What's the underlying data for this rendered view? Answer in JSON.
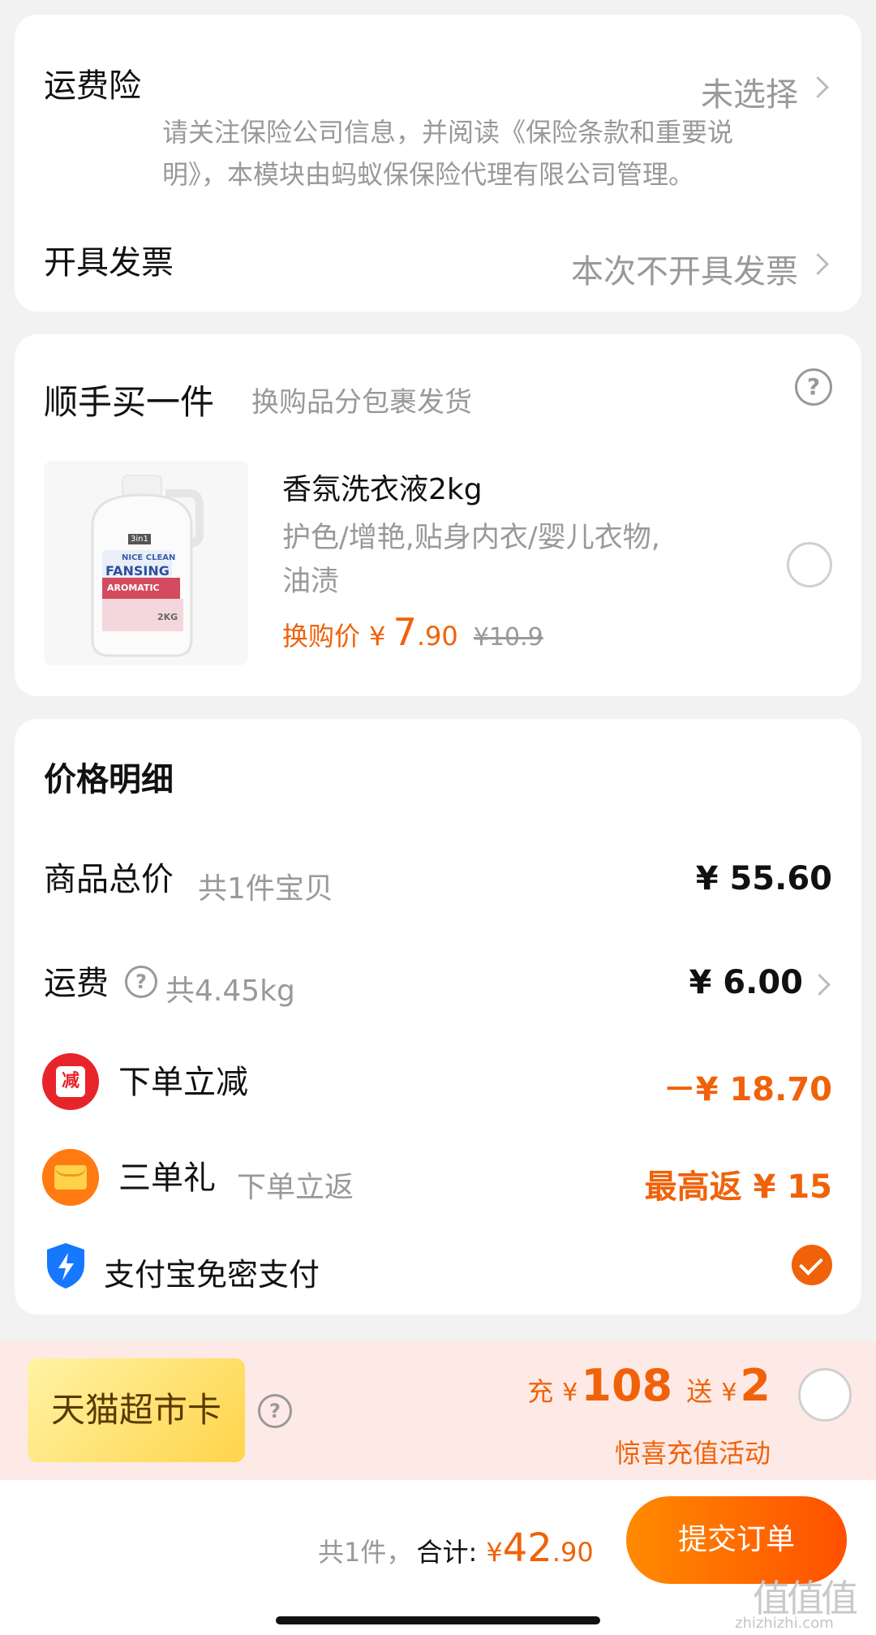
{
  "insurance": {
    "label": "运费险",
    "value": "未选择",
    "note_line1": "请关注保险公司信息，并阅读《保险条款和重要说",
    "note_line2": "明》，本模块由蚂蚁保保险代理有限公司管理。"
  },
  "invoice": {
    "label": "开具发票",
    "value": "本次不开具发票"
  },
  "addon": {
    "title": "顺手买一件",
    "subtitle": "换购品分包裹发货",
    "product": {
      "name": "香氛洗衣液2kg",
      "desc_line1": "护色/增艳,贴身内衣/婴儿衣物,",
      "desc_line2": "油渍",
      "price_label": "换购价",
      "currency": "¥",
      "price_int": "7",
      "price_dec": ".90",
      "original_price": "¥10.9",
      "image_icon": "laundry-bottle-image",
      "bottle_brand": "FANSING",
      "bottle_top": "NICE CLEAN",
      "bottle_band": "AROMATIC",
      "bottle_size": "2KG",
      "bottle_badge": "3in1"
    }
  },
  "price_detail": {
    "title": "价格明细",
    "goods_label": "商品总价",
    "goods_sub": "共1件宝贝",
    "goods_value": "¥ 55.60",
    "shipping_label": "运费",
    "shipping_sub": "共4.45kg",
    "shipping_value": "¥ 6.00",
    "discount_icon_text": "减",
    "discount_label": "下单立减",
    "discount_value": "－¥ 18.70",
    "gift_label": "三单礼",
    "gift_sub": "下单立返",
    "gift_value": "最高返 ¥ 15",
    "alipay_label": "支付宝免密支付",
    "alipay_checked": true
  },
  "supermarket": {
    "badge": "天猫超市卡",
    "charge_prefix": "充",
    "charge_currency": "¥",
    "charge_amount": "108",
    "gift_prefix": "送",
    "gift_currency": "¥",
    "gift_amount": "2",
    "note": "惊喜充值活动"
  },
  "footer": {
    "count_text": "共1件，",
    "total_label": "合计:",
    "currency": "¥",
    "total_int": "42",
    "total_dec": ".90",
    "submit_label": "提交订单"
  },
  "watermark": {
    "text": "值值值",
    "url": "zhizhizhi.com"
  },
  "colors": {
    "accent": "#f0620a",
    "submit_gradient": [
      "#ff8a00",
      "#ff5000"
    ]
  }
}
